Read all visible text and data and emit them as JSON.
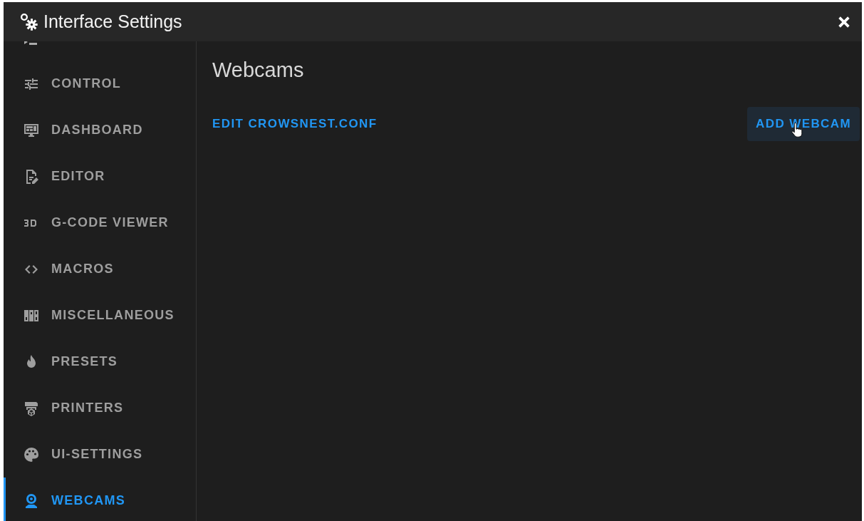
{
  "window": {
    "title": "Interface Settings"
  },
  "sidebar": {
    "items": [
      {
        "label": "CONTROL",
        "selected": false
      },
      {
        "label": "DASHBOARD",
        "selected": false
      },
      {
        "label": "EDITOR",
        "selected": false
      },
      {
        "label": "G-CODE VIEWER",
        "selected": false
      },
      {
        "label": "MACROS",
        "selected": false
      },
      {
        "label": "MISCELLANEOUS",
        "selected": false
      },
      {
        "label": "PRESETS",
        "selected": false
      },
      {
        "label": "PRINTERS",
        "selected": false
      },
      {
        "label": "UI-SETTINGS",
        "selected": false
      },
      {
        "label": "WEBCAMS",
        "selected": true
      }
    ]
  },
  "content": {
    "heading": "Webcams",
    "actions": [
      {
        "label": "EDIT CROWSNEST.CONF",
        "hovered": false
      },
      {
        "label": "ADD WEBCAM",
        "hovered": true
      }
    ]
  }
}
